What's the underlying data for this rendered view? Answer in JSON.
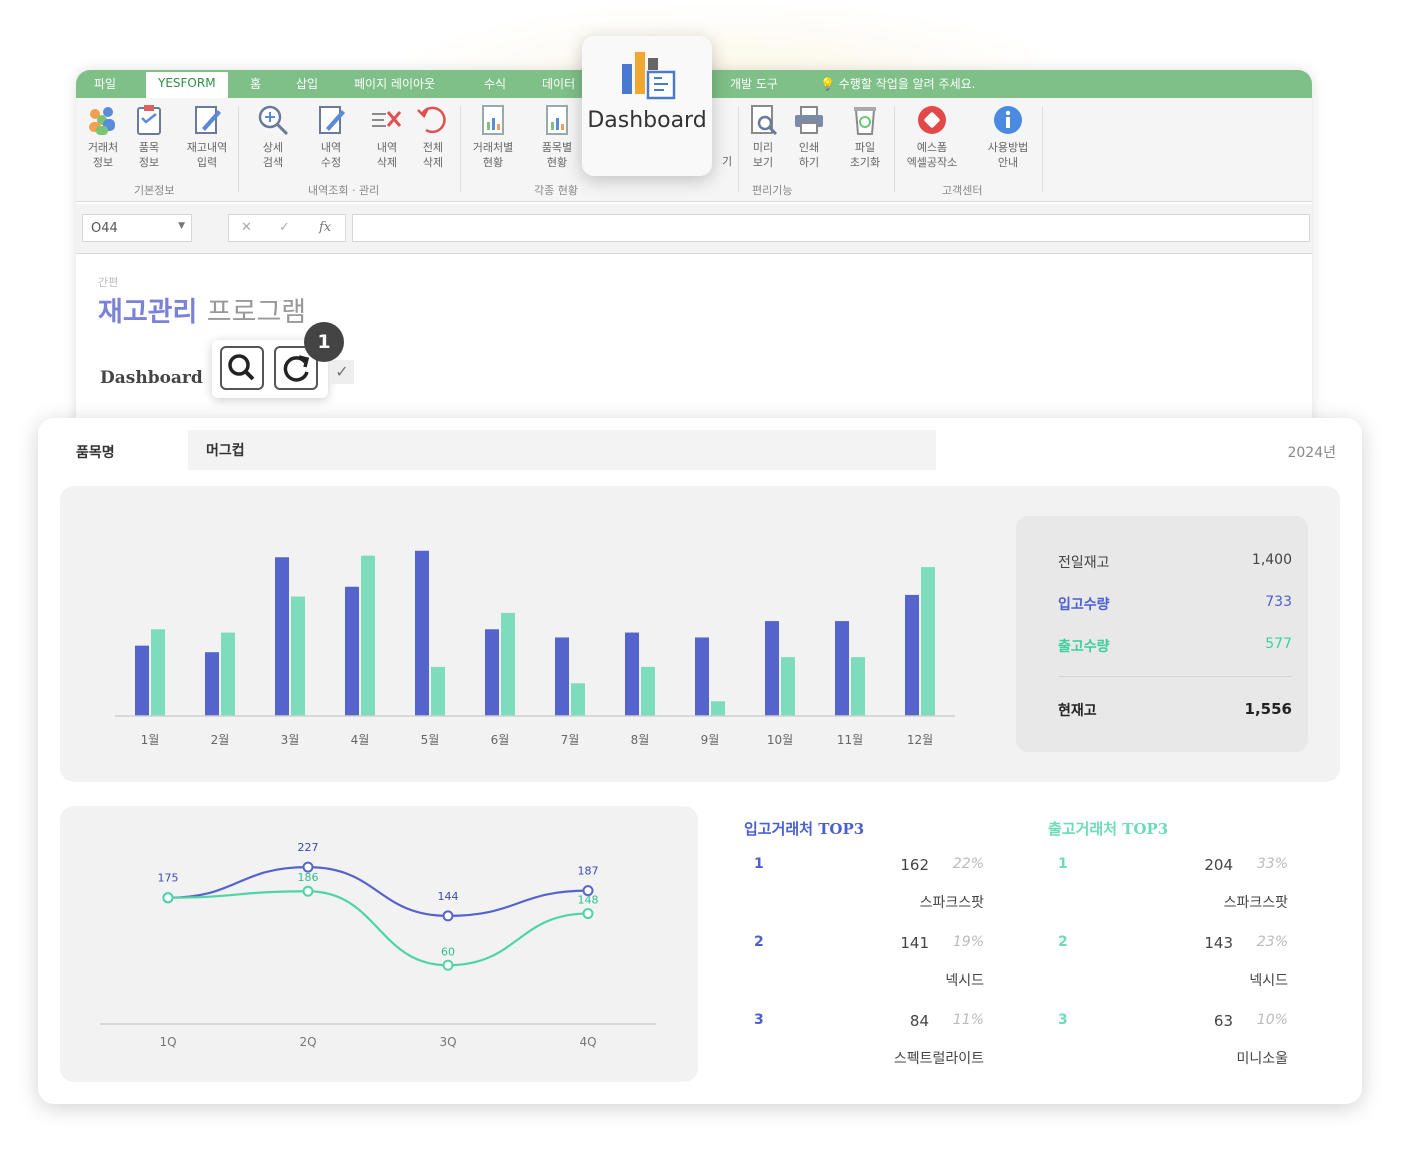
{
  "colors": {
    "ribbon_green": "#7fbf88",
    "blue": "#5564cc",
    "mint": "#7ddcbc",
    "title_blue": "#7a82d8"
  },
  "excel": {
    "tabs": [
      "파일",
      "YESFORM",
      "홈",
      "삽입",
      "페이지 레이아웃",
      "수식",
      "데이터",
      "개발 도구",
      "수행할 작업을 알려 주세요."
    ],
    "ribbon_groups": [
      "기본정보",
      "내역조회 · 관리",
      "각종 현황",
      "편리기능",
      "고객센터"
    ],
    "ribbon_buttons": [
      {
        "label": "거래처\n정보",
        "icon": "people-icon"
      },
      {
        "label": "품목\n정보",
        "icon": "clipboard-icon"
      },
      {
        "label": "재고내역\n입력",
        "icon": "edit-doc-icon"
      },
      {
        "label": "상세\n검색",
        "icon": "zoom-icon"
      },
      {
        "label": "내역\n수정",
        "icon": "edit-doc-icon"
      },
      {
        "label": "내역\n삭제",
        "icon": "delete-icon"
      },
      {
        "label": "전체\n삭제",
        "icon": "undo-delete-icon"
      },
      {
        "label": "거래처별\n현황",
        "icon": "report-icon"
      },
      {
        "label": "품목별\n현황",
        "icon": "report-icon"
      },
      {
        "label": "미리\n보기",
        "icon": "preview-icon"
      },
      {
        "label": "인쇄\n하기",
        "icon": "printer-icon"
      },
      {
        "label": "파일\n초기화",
        "icon": "recycle-icon"
      },
      {
        "label": "예스폼\n엑셀공작소",
        "icon": "yesform-icon"
      },
      {
        "label": "사용방법\n안내",
        "icon": "info-icon"
      }
    ],
    "name_box": "O44",
    "fx_label": "fx",
    "sheet_small_label": "간편",
    "sheet_title_main": "재고관리",
    "sheet_title_rest": "프로그램",
    "dashboard_label": "Dashboard",
    "popup_label": "Dashboard",
    "partial_button_label": "기",
    "badge_number": "1"
  },
  "panel": {
    "item_label": "품목명",
    "item_value": "머그컵",
    "year": "2024년",
    "summary": [
      {
        "key": "전일재고",
        "value": "1,400",
        "color": "#444"
      },
      {
        "key": "입고수량",
        "value": "733",
        "color": "#4a5fd0"
      },
      {
        "key": "출고수량",
        "value": "577",
        "color": "#3ccf9c"
      },
      {
        "key": "현재고",
        "value": "1,556",
        "color": "#222"
      }
    ],
    "top3_in": {
      "title": "입고거래처 TOP3",
      "rows": [
        {
          "rank": "1",
          "count": "162",
          "pct": "22%",
          "name": "스파크스팟"
        },
        {
          "rank": "2",
          "count": "141",
          "pct": "19%",
          "name": "넥시드"
        },
        {
          "rank": "3",
          "count": "84",
          "pct": "11%",
          "name": "스펙트럴라이트"
        }
      ]
    },
    "top3_out": {
      "title": "출고거래처 TOP3",
      "rows": [
        {
          "rank": "1",
          "count": "204",
          "pct": "33%",
          "name": "스파크스팟"
        },
        {
          "rank": "2",
          "count": "143",
          "pct": "23%",
          "name": "넥시드"
        },
        {
          "rank": "3",
          "count": "63",
          "pct": "10%",
          "name": "미니소울"
        }
      ]
    }
  },
  "chart_data": [
    {
      "type": "bar",
      "categories": [
        "1월",
        "2월",
        "3월",
        "4월",
        "5월",
        "6월",
        "7월",
        "8월",
        "9월",
        "10월",
        "11월",
        "12월"
      ],
      "series": [
        {
          "values": [
            43,
            39,
            97,
            79,
            101,
            53,
            48,
            51,
            48,
            58,
            58,
            74
          ]
        },
        {
          "values": [
            53,
            51,
            73,
            98,
            30,
            63,
            20,
            30,
            9,
            36,
            36,
            91
          ]
        }
      ],
      "ylim": [
        0,
        110
      ],
      "grid": false,
      "legend": "none"
    },
    {
      "type": "line",
      "categories": [
        "1Q",
        "2Q",
        "3Q",
        "4Q"
      ],
      "series": [
        {
          "values": [
            175,
            227,
            144,
            187
          ]
        },
        {
          "values": [
            175,
            186,
            60,
            148
          ]
        }
      ],
      "data_labels": [
        [
          "175",
          "227",
          "144",
          "187"
        ],
        [
          "",
          "186",
          "60",
          "148"
        ]
      ],
      "ylim": [
        -40,
        280
      ],
      "grid": false,
      "legend": "none"
    }
  ]
}
